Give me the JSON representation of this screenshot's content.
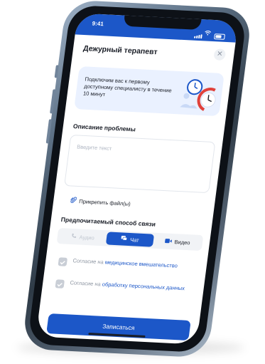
{
  "status_bar": {
    "time": "9:41"
  },
  "modal": {
    "title": "Дежурный терапевт"
  },
  "banner": {
    "text": "Подключим вас к первому доступному специалисту в течение 10 минут",
    "illustration": "clock-illustration"
  },
  "problem": {
    "section_title": "Описание проблемы",
    "placeholder": "Введите текст",
    "value": ""
  },
  "attach": {
    "label": "Прикрепить файл(ы)",
    "icon": "paperclip-icon"
  },
  "contact": {
    "section_title": "Предпочитаемый способ связи",
    "options": [
      {
        "label": "Аудио",
        "icon": "phone-icon",
        "state": "disabled"
      },
      {
        "label": "Чат",
        "icon": "chat-icon",
        "state": "selected"
      },
      {
        "label": "Видео",
        "icon": "video-icon",
        "state": "default"
      }
    ]
  },
  "consents": [
    {
      "prefix": "Согласие на ",
      "link": "медицинское вмешательство",
      "checked": true
    },
    {
      "prefix": "Согласие на ",
      "link": "обработку персональных данных",
      "checked": true
    }
  ],
  "submit": {
    "label": "Записаться"
  },
  "colors": {
    "accent": "#1c57c8",
    "banner_bg": "#eaf1ff",
    "muted_text": "#8f97a3",
    "phone_frame": "#5f7388"
  }
}
